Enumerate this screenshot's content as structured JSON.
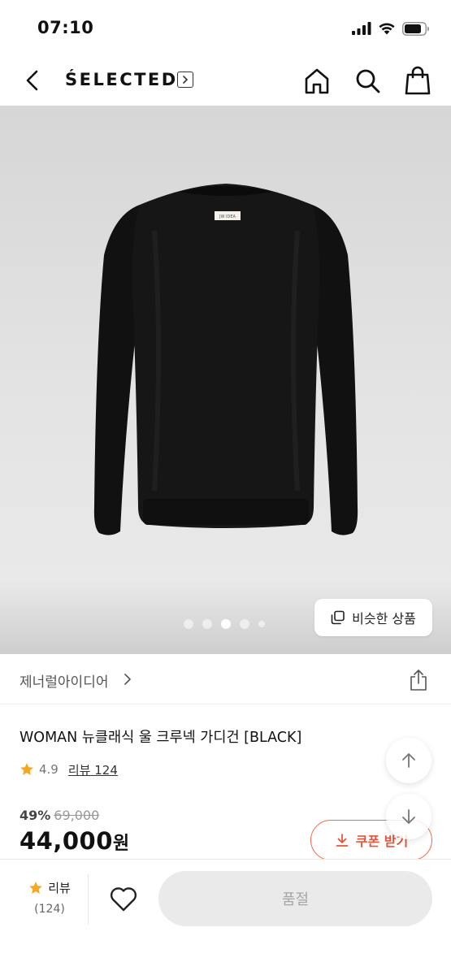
{
  "status_bar": {
    "time": "07:10"
  },
  "nav": {
    "brand_logo": "ŚELECTED",
    "icons": [
      "back-chevron-icon",
      "brand-link-chevron-icon",
      "home-icon",
      "search-icon",
      "shopping-bag-icon"
    ]
  },
  "hero": {
    "garment_label": "JW IDEA",
    "dots_total": 5,
    "dots_active_index": 2,
    "similar_button_label": "비슷한 상품"
  },
  "brand": {
    "name": "제너럴아이디어"
  },
  "product": {
    "title": "WOMAN 뉴클래식 울 크루넥 가디건 [BLACK]",
    "rating": "4.9",
    "review_link": "리뷰 124",
    "discount_rate": "49%",
    "original_price": "69,000",
    "sale_price": "44,000",
    "currency_unit": "원",
    "coupon_label": "쿠폰 받기"
  },
  "bottom_bar": {
    "review_label": "리뷰",
    "review_count": "(124)",
    "soldout_label": "품절"
  },
  "colors": {
    "accent_coupon": "#e8543a",
    "star": "#f5a623",
    "soldout_bg": "#eaeaea"
  }
}
